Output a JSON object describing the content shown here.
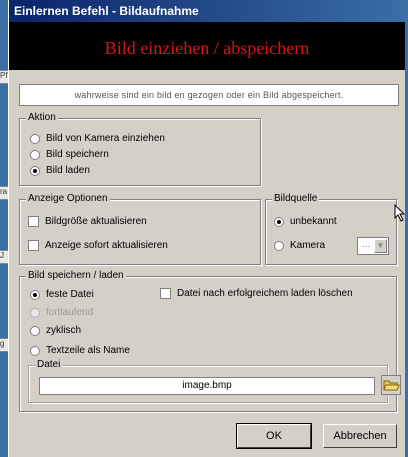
{
  "window": {
    "title": "Einlernen Befehl - Bildaufnahme"
  },
  "banner": {
    "title": "Bild einziehen / abspeichern"
  },
  "info_text": "wahrweise sind ein bild en gezogen oder ein Bild abgespeichert.",
  "aktion": {
    "label": "Aktion",
    "options": [
      {
        "label": "Bild von Kamera einziehen",
        "selected": false
      },
      {
        "label": "Bild speichern",
        "selected": false
      },
      {
        "label": "Bild laden",
        "selected": true
      }
    ]
  },
  "anzeige": {
    "label": "Anzeige Optionen",
    "options": [
      {
        "label": "Bildgröße aktualisieren",
        "checked": false
      },
      {
        "label": "Anzeige sofort aktualisieren",
        "checked": false
      }
    ]
  },
  "bildquelle": {
    "label": "Bildquelle",
    "options": [
      {
        "label": "unbekannt",
        "selected": true
      },
      {
        "label": "Kamera",
        "selected": false
      }
    ],
    "camera_select": {
      "value": "..."
    }
  },
  "speichern": {
    "label": "Bild speichern / laden",
    "options": [
      {
        "label": "feste Datei",
        "selected": true,
        "enabled": true
      },
      {
        "label": "fortlaufend",
        "selected": false,
        "enabled": false
      },
      {
        "label": "zyklisch",
        "selected": false,
        "enabled": true
      },
      {
        "label": "Textzeile als Name",
        "selected": false,
        "enabled": true
      }
    ],
    "delete_checkbox": {
      "label": "Datei nach erfolgreichem laden löschen",
      "checked": false
    },
    "datei": {
      "label": "Datei",
      "value": "image.bmp"
    }
  },
  "buttons": {
    "ok": "OK",
    "cancel": "Abbrechen"
  },
  "background": {
    "left_strip_texts": [
      "Pf",
      "ra",
      "J",
      "g"
    ]
  },
  "colors": {
    "title_start": "#0a246a",
    "title_end": "#3a6ea5",
    "banner_bg": "#000000",
    "banner_text": "#e01010"
  }
}
